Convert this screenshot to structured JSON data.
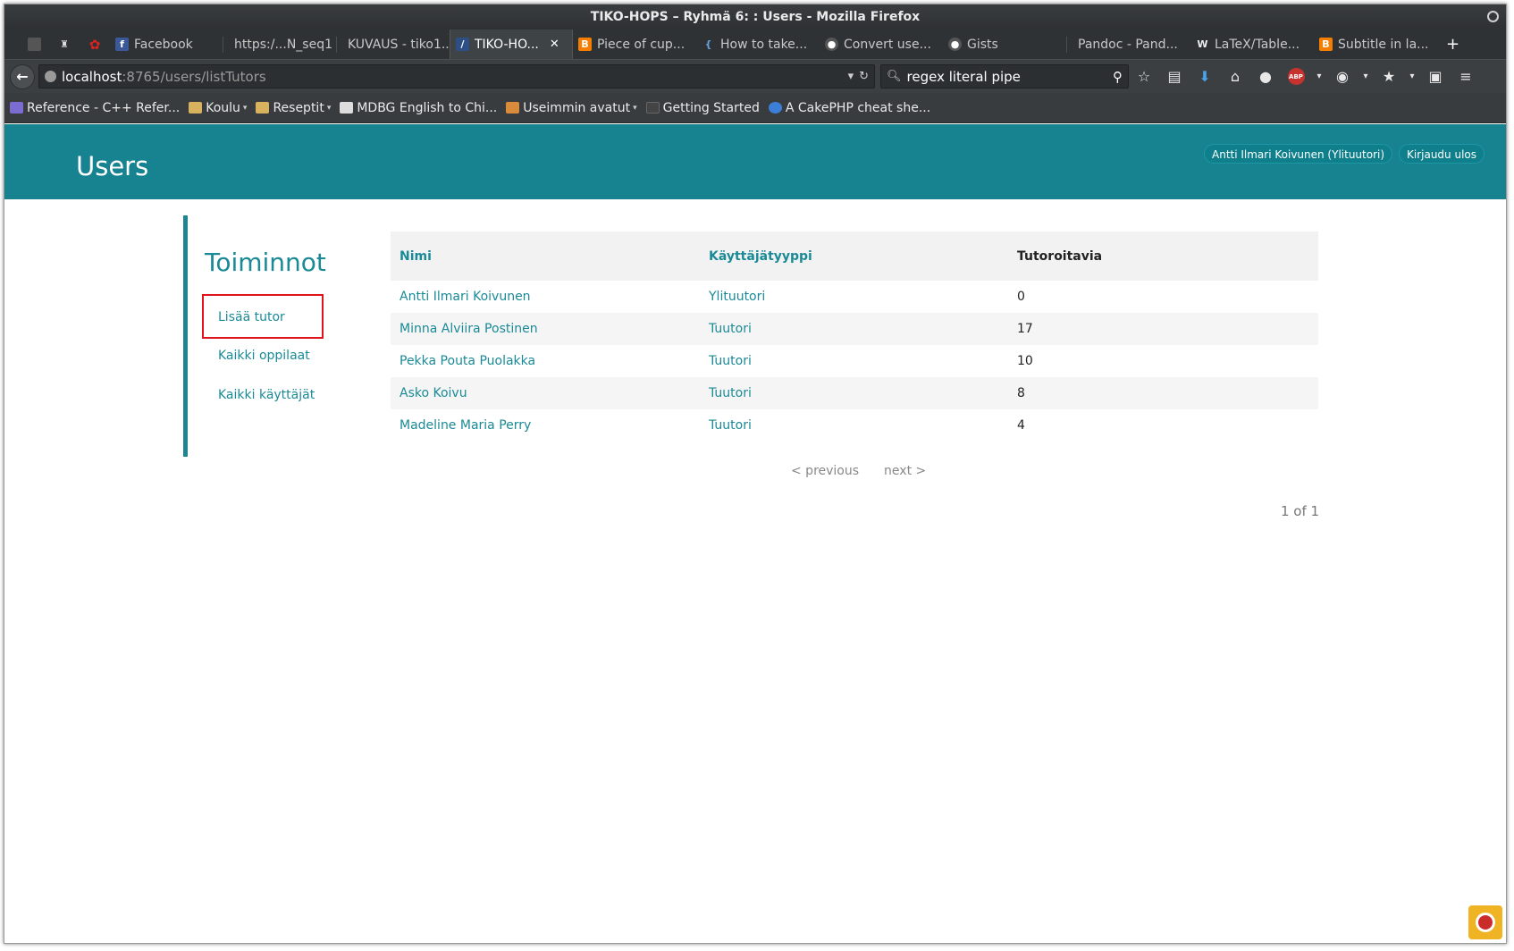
{
  "window": {
    "title": "TIKO-HOPS – Ryhmä 6: : Users - Mozilla Firefox"
  },
  "tabs": [
    {
      "label": "",
      "icon": "blank-icon"
    },
    {
      "label": "",
      "icon": "bottle-icon"
    },
    {
      "label": "",
      "icon": "flower-icon"
    },
    {
      "label": "Facebook",
      "icon": "facebook-icon"
    },
    {
      "label": "https:/...N_seq1",
      "icon": ""
    },
    {
      "label": "KUVAUS - tiko1...",
      "icon": ""
    },
    {
      "label": "TIKO-HO...",
      "icon": "tiko-icon",
      "active": true
    },
    {
      "label": "Piece of cup...",
      "icon": "blogger-icon"
    },
    {
      "label": "How to take...",
      "icon": "stackoverflow-icon"
    },
    {
      "label": "Convert use...",
      "icon": "github-icon"
    },
    {
      "label": "Gists",
      "icon": "github-icon"
    },
    {
      "label": "Pandoc - Pand...",
      "icon": ""
    },
    {
      "label": "LaTeX/Table...",
      "icon": "wikibooks-icon"
    },
    {
      "label": "Subtitle in la...",
      "icon": "blogger-icon"
    }
  ],
  "nav": {
    "url_host": "localhost",
    "url_path": ":8765/users/listTutors",
    "search_value": "regex literal pipe"
  },
  "bookmarks": [
    {
      "label": "Reference - C++ Refer...",
      "type": "link"
    },
    {
      "label": "Koulu",
      "type": "folder"
    },
    {
      "label": "Reseptit",
      "type": "folder"
    },
    {
      "label": "MDBG English to Chi...",
      "type": "link"
    },
    {
      "label": "Useimmin avatut",
      "type": "folder"
    },
    {
      "label": "Getting Started",
      "type": "link"
    },
    {
      "label": "A CakePHP cheat she...",
      "type": "link"
    }
  ],
  "page": {
    "title": "Users",
    "user_badge": "Antti Ilmari Koivunen (Ylituutori)",
    "logout": "Kirjaudu ulos"
  },
  "actions": {
    "heading": "Toiminnot",
    "items": [
      "Lisää tutor",
      "Kaikki oppilaat",
      "Kaikki käyttäjät"
    ]
  },
  "table": {
    "headers": [
      "Nimi",
      "Käyttäjätyyppi",
      "Tutoroitavia"
    ],
    "rows": [
      [
        "Antti Ilmari Koivunen",
        "Ylituutori",
        "0"
      ],
      [
        "Minna Alviira Postinen",
        "Tuutori",
        "17"
      ],
      [
        "Pekka Pouta Puolakka",
        "Tuutori",
        "10"
      ],
      [
        "Asko Koivu",
        "Tuutori",
        "8"
      ],
      [
        "Madeline Maria Perry",
        "Tuutori",
        "4"
      ]
    ]
  },
  "pagination": {
    "previous": "< previous",
    "next": "next >",
    "count": "1 of 1"
  },
  "colors": {
    "header": "#178290",
    "link": "#1a8a96",
    "highlight": "#e0121b"
  }
}
